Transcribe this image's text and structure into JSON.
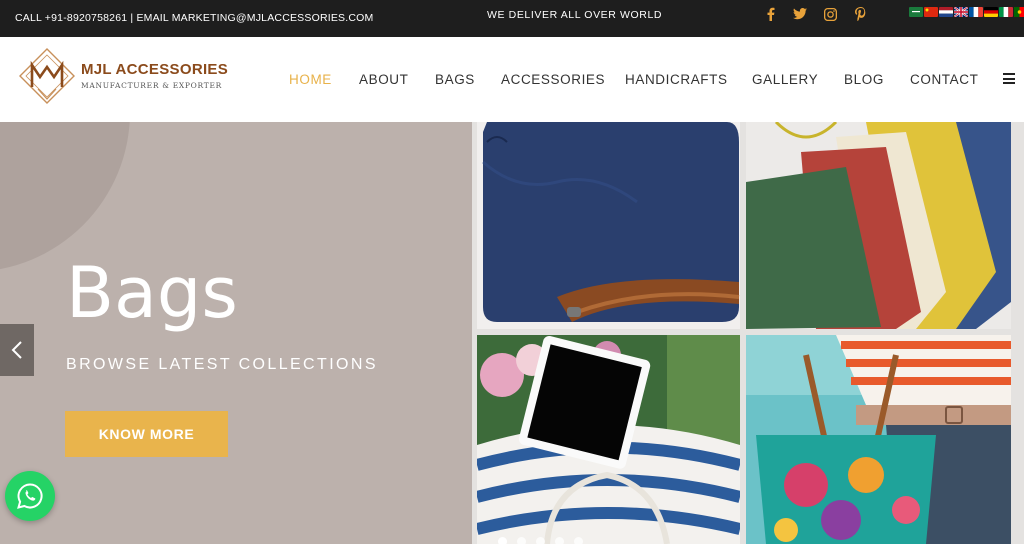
{
  "topbar": {
    "contact_text": "CALL +91-8920758261 | EMAIL MARKETING@MJLACCESSORIES.COM",
    "tagline": "WE DELIVER ALL OVER WORLD",
    "social_icons": [
      "facebook-icon",
      "twitter-icon",
      "instagram-icon",
      "pinterest-icon"
    ],
    "social_color": "#e8a23a",
    "languages": [
      "arabic",
      "chinese",
      "dutch",
      "english",
      "french",
      "german",
      "italian",
      "portuguese"
    ]
  },
  "header": {
    "logo_title": "MJL ACCESSORIES",
    "logo_subtitle": "MANUFACTURER & EXPORTER",
    "brand_color": "#8b4b1c",
    "nav": [
      {
        "label": "HOME",
        "active": true
      },
      {
        "label": "ABOUT",
        "active": false
      },
      {
        "label": "BAGS",
        "active": false
      },
      {
        "label": "ACCESSORIES",
        "active": false
      },
      {
        "label": "HANDICRAFTS",
        "active": false
      },
      {
        "label": "GALLERY",
        "active": false
      },
      {
        "label": "BLOG",
        "active": false
      },
      {
        "label": "CONTACT",
        "active": false
      }
    ],
    "active_color": "#e8b24a"
  },
  "hero": {
    "title": "Bags",
    "subtitle": "BROWSE LATEST COLLECTIONS",
    "button_label": "KNOW MORE",
    "button_color": "#e9b44c",
    "slide_count": 5,
    "active_slide": 1
  }
}
